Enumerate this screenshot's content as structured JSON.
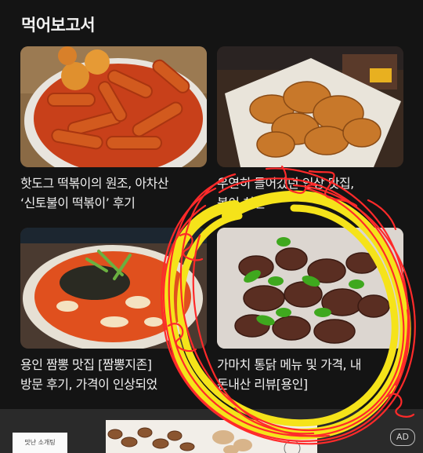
{
  "section": {
    "title": "먹어보고서"
  },
  "cards": [
    {
      "caption_line1": "핫도그 떡볶이의 원조, 아차산",
      "caption_line2": "‘신토불이 떡볶이’ 후기"
    },
    {
      "caption_line1": "우연히 들어갔던 인상 맛집,",
      "caption_line2": "봉이 치킨"
    },
    {
      "caption_line1": "용인 짬뽕 맛집 [짬뽕지존]",
      "caption_line2": "방문 후기, 가격이 인상되었"
    },
    {
      "caption_line1": "가마치 통닭 메뉴 및 가격, 내",
      "caption_line2": "돈내산 리뷰[용인]"
    }
  ],
  "ad": {
    "badge": "AD",
    "brand_text": "맛난 소개팅"
  },
  "colors": {
    "background": "#141414",
    "scribble_yellow": "#f5e31a",
    "scribble_red": "#ff2a2a"
  }
}
